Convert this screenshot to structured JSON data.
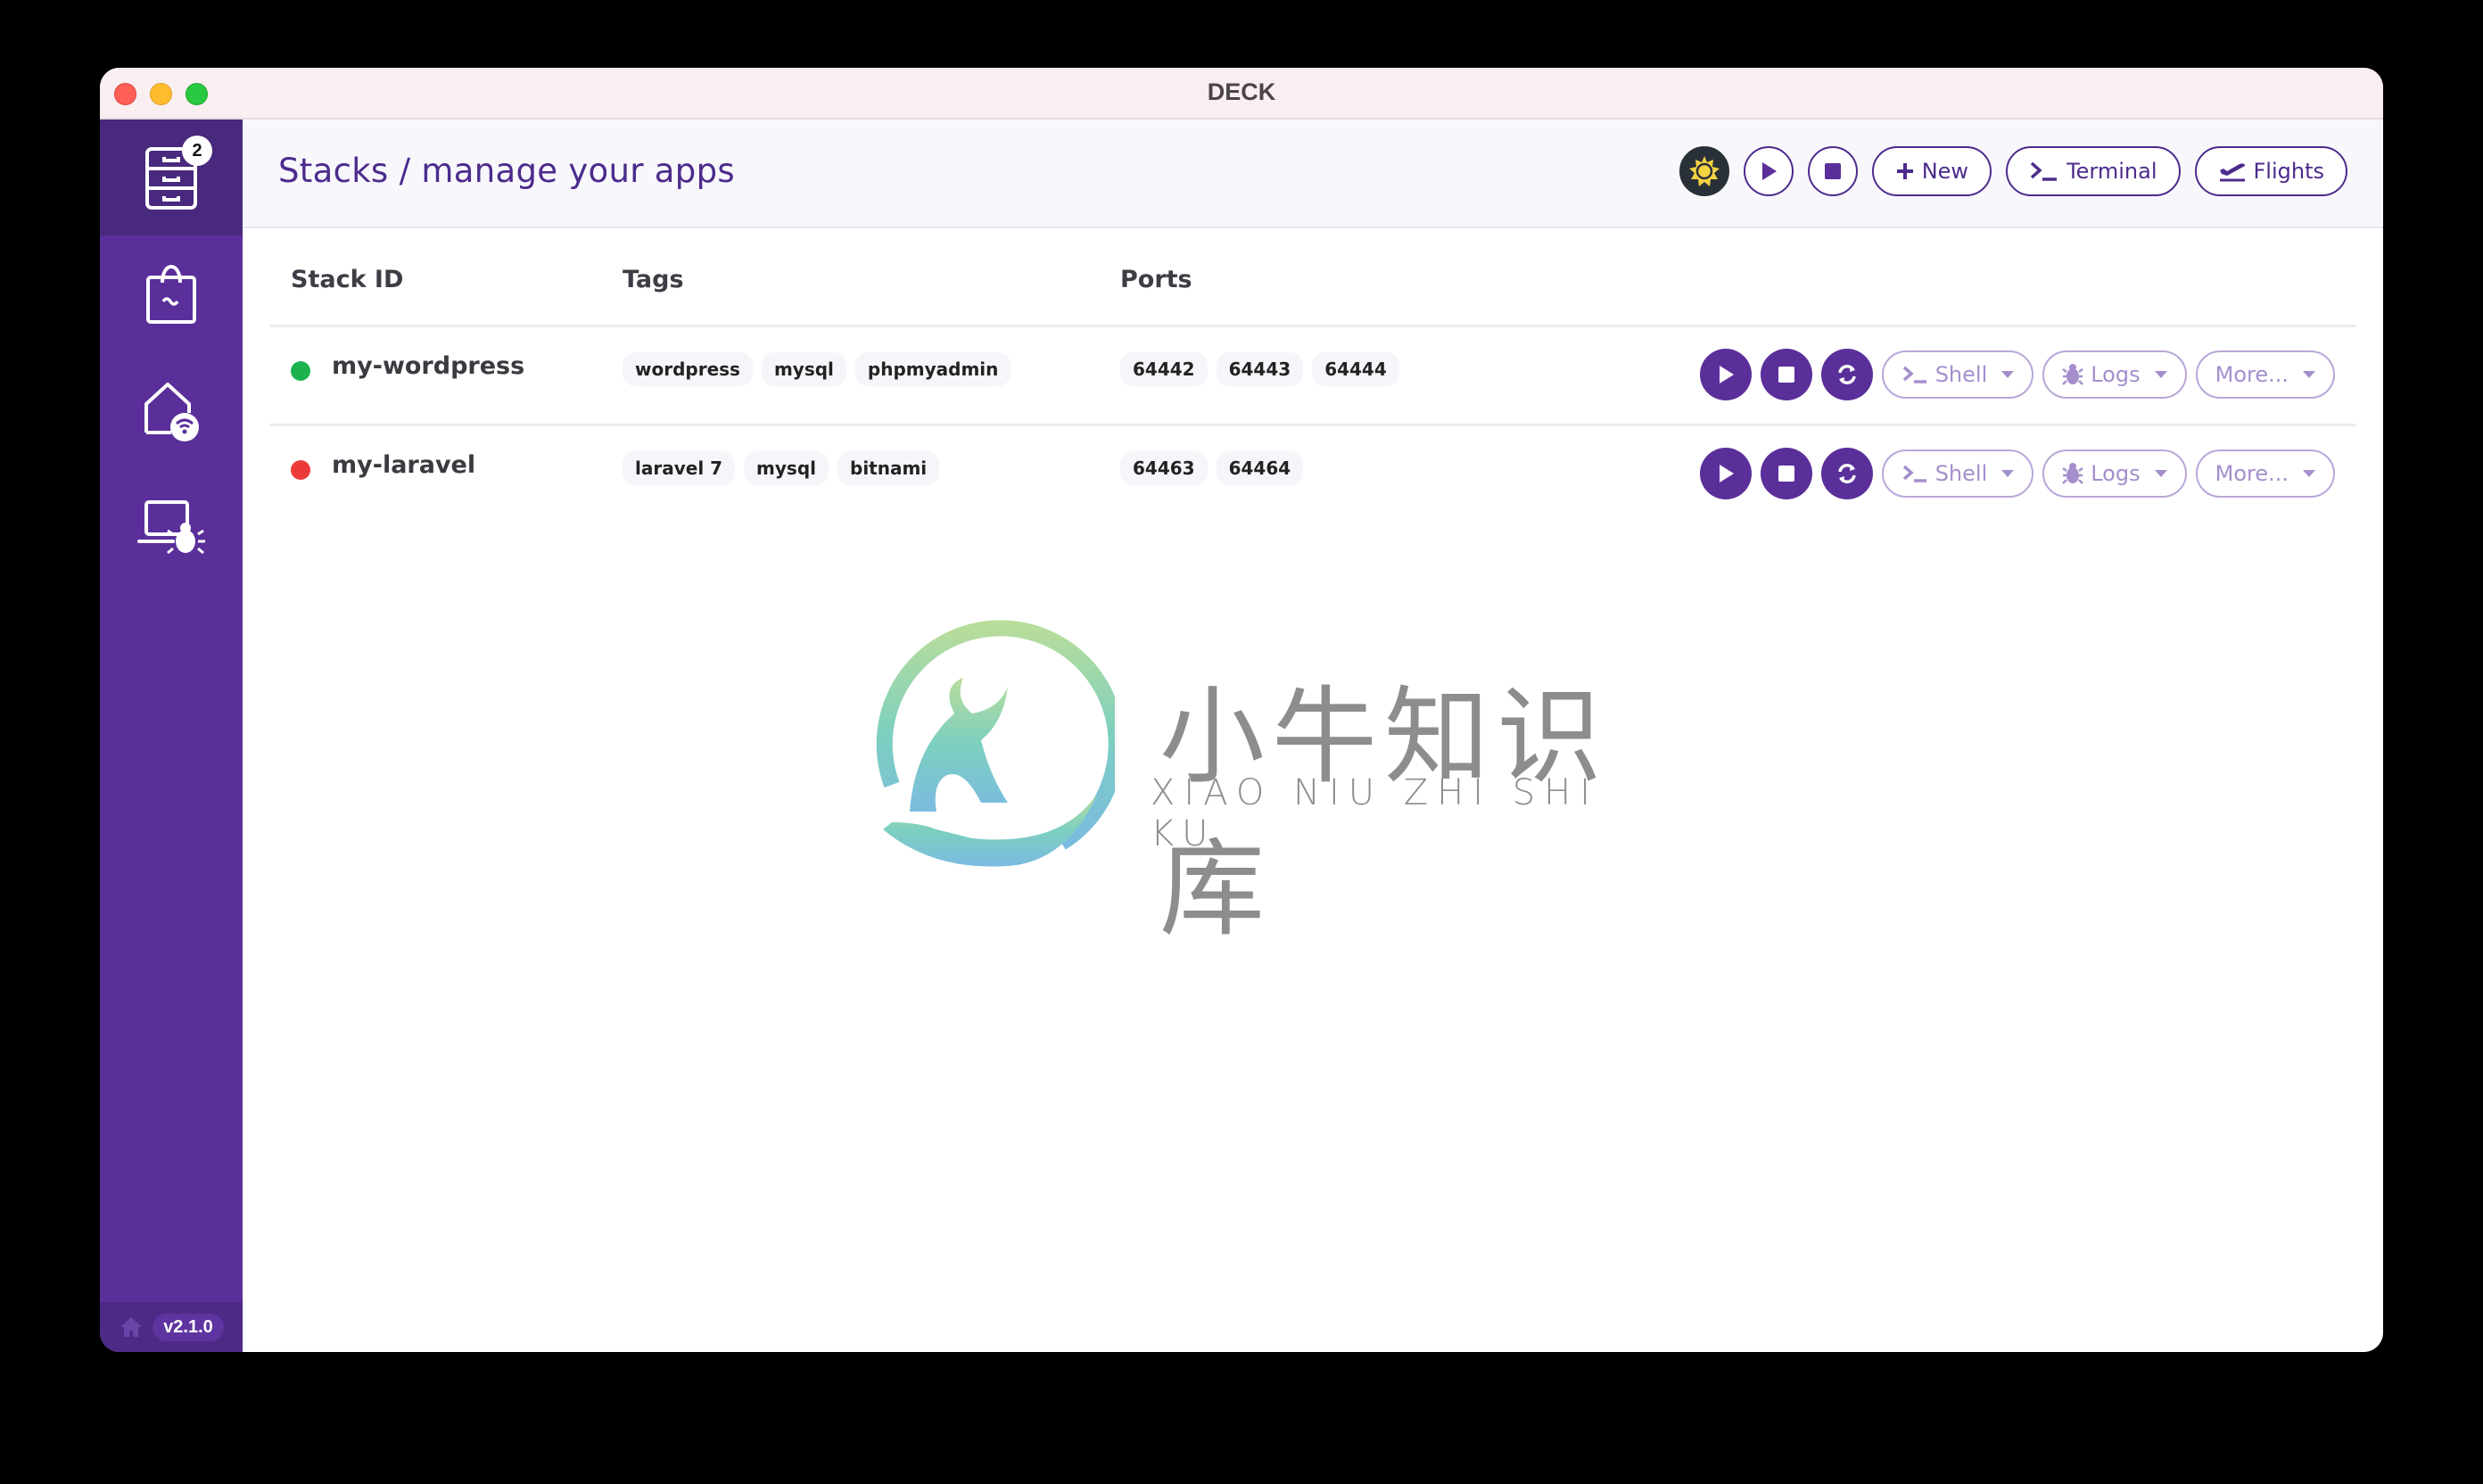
{
  "window": {
    "title": "DECK"
  },
  "sidebar": {
    "items": [
      {
        "name": "stacks",
        "badge": "2",
        "active": true
      },
      {
        "name": "marketplace"
      },
      {
        "name": "network"
      },
      {
        "name": "debug"
      }
    ],
    "version": "v2.1.0"
  },
  "header": {
    "title": "Stacks / manage your apps",
    "buttons": {
      "new": "New",
      "terminal": "Terminal",
      "flights": "Flights"
    }
  },
  "table": {
    "columns": [
      "Stack ID",
      "Tags",
      "Ports"
    ],
    "rows": [
      {
        "id": "my-wordpress",
        "status": "running",
        "status_color": "#1cb34f",
        "tags": [
          "wordpress",
          "mysql",
          "phpmyadmin"
        ],
        "ports": [
          "64442",
          "64443",
          "64444"
        ]
      },
      {
        "id": "my-laravel",
        "status": "stopped",
        "status_color": "#ec3a3a",
        "tags": [
          "laravel 7",
          "mysql",
          "bitnami"
        ],
        "ports": [
          "64463",
          "64464"
        ]
      }
    ],
    "row_actions": {
      "shell": "Shell",
      "logs": "Logs",
      "more": "More..."
    }
  },
  "watermark": {
    "cn": "小牛知识库",
    "en": "XIAO NIU ZHI SHI KU"
  },
  "colors": {
    "brand": "#5a2f9a",
    "brand_dark": "#48297d",
    "accent_light": "#a48fcc"
  }
}
